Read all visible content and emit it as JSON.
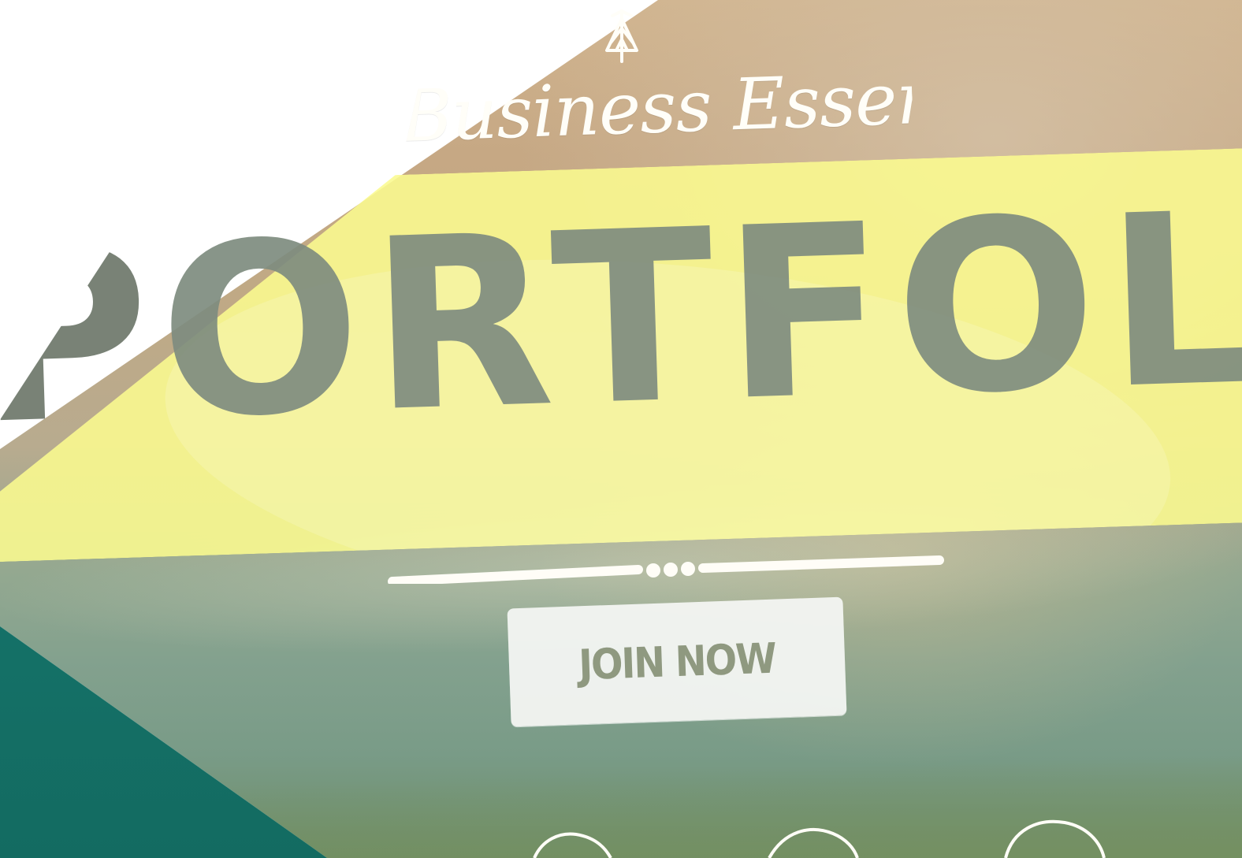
{
  "brand": {
    "name": "Business Essentials",
    "logo_icon": "tower-logo-icon"
  },
  "hero": {
    "title": "PORTFOLIO",
    "divider_icon": "divider-dots-icon",
    "cta_label": "JOIN NOW"
  },
  "icons": [
    "circle-outline-icon",
    "circle-outline-icon",
    "circle-outline-icon"
  ],
  "colors": {
    "banner": "#FAFA90",
    "teal": "#178078",
    "button": "#F2F5F1",
    "text": "#8F9980"
  }
}
